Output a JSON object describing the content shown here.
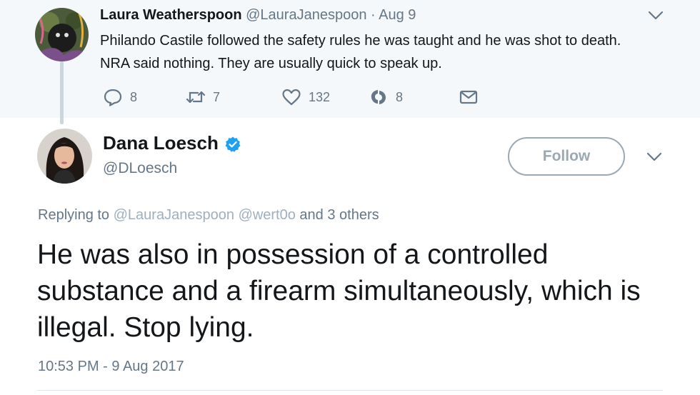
{
  "parent_tweet": {
    "name": "Laura Weatherspoon",
    "handle": "@LauraJanespoon",
    "separator": " · ",
    "date": "Aug 9",
    "text": "Philando Castile followed the safety rules he was taught and he was shot to death. NRA said nothing. They are usually quick to speak up.",
    "actions": {
      "reply_count": "8",
      "retweet_count": "7",
      "like_count": "132",
      "moment_count": "8"
    }
  },
  "main_tweet": {
    "name": "Dana Loesch",
    "handle": "@DLoesch",
    "follow_label": "Follow",
    "replying_prefix": "Replying to",
    "mention_1": "@LauraJanespoon",
    "mention_2": "@wert0o",
    "replying_suffix": "and 3 others",
    "text": "He was also in possession of a controlled substance and a firearm simultaneously, which is illegal. Stop lying.",
    "timestamp": "10:53 PM - 9 Aug 2017"
  },
  "colors": {
    "accent": "#1da1f2",
    "secondary_text": "#657786",
    "parent_background": "#f5f8fa",
    "follow_border": "#9aa9b3"
  }
}
